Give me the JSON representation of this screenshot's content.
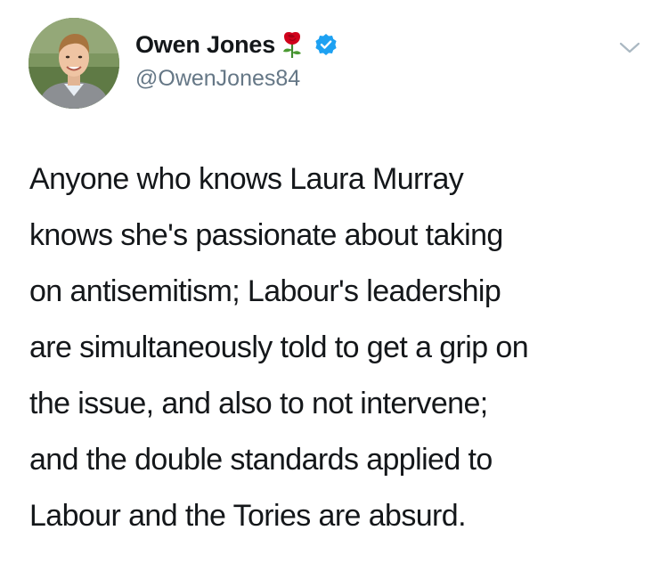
{
  "author": {
    "display_name": "Owen Jones",
    "handle": "@OwenJones84",
    "name_emoji_icon": "rose-icon",
    "verified_icon": "verified-badge-icon",
    "avatar_icon": "profile-photo"
  },
  "menu": {
    "icon": "chevron-down-icon"
  },
  "tweet": {
    "lines": [
      "Anyone who knows Laura Murray",
      "knows she's passionate about taking",
      "on antisemitism; Labour's leadership",
      "are simultaneously told to get a grip on",
      "the issue, and also to not intervene;",
      "and the double standards applied to",
      "Labour and the Tories are absurd."
    ]
  },
  "colors": {
    "text": "#14171a",
    "secondary_text": "#657786",
    "verified_blue": "#1da1f2",
    "rose_red": "#d0021b"
  }
}
